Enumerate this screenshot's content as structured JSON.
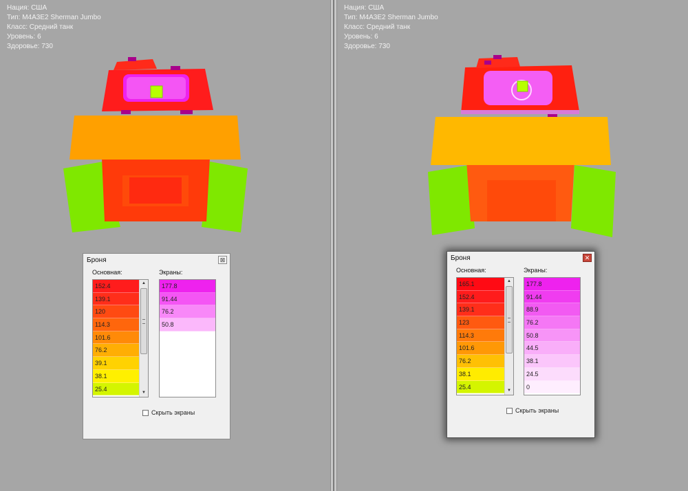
{
  "left": {
    "info": {
      "nation": "Нация: США",
      "type": "Тип: M4A3E2 Sherman Jumbo",
      "class": "Класс: Средний танк",
      "tier": "Уровень: 6",
      "health": "Здоровье: 730"
    },
    "window": {
      "title": "Броня",
      "close_glyph": "⊠",
      "main_header": "Основная:",
      "screens_header": "Экраны:",
      "hide_screens_label": "Скрыть экраны",
      "main_rows": [
        {
          "value": "152.4",
          "color": "#ff1c1c"
        },
        {
          "value": "139.1",
          "color": "#ff2e1a"
        },
        {
          "value": "120",
          "color": "#ff4a12"
        },
        {
          "value": "114.3",
          "color": "#ff660c"
        },
        {
          "value": "101.6",
          "color": "#ff8a08"
        },
        {
          "value": "76.2",
          "color": "#ffae04"
        },
        {
          "value": "39.1",
          "color": "#ffd202"
        },
        {
          "value": "38.1",
          "color": "#fff000"
        },
        {
          "value": "25.4",
          "color": "#d4f500"
        }
      ],
      "screen_rows": [
        {
          "value": "177.8",
          "color": "#ee22ee"
        },
        {
          "value": "91.44",
          "color": "#f455f4"
        },
        {
          "value": "76.2",
          "color": "#f888f8"
        },
        {
          "value": "50.8",
          "color": "#fbb8fb"
        }
      ]
    }
  },
  "right": {
    "info": {
      "nation": "Нация: США",
      "type": "Тип: M4A3E2 Sherman Jumbo",
      "class": "Класс: Средний танк",
      "tier": "Уровень: 6",
      "health": "Здоровье: 730"
    },
    "window": {
      "title": "Броня",
      "close_glyph": "✕",
      "main_header": "Основная:",
      "screens_header": "Экраны:",
      "hide_screens_label": "Скрыть экраны",
      "main_rows": [
        {
          "value": "165.1",
          "color": "#ff0a14"
        },
        {
          "value": "152.4",
          "color": "#ff1c1c"
        },
        {
          "value": "139.1",
          "color": "#ff2e1a"
        },
        {
          "value": "123",
          "color": "#ff5a10"
        },
        {
          "value": "114.3",
          "color": "#ff7a0a"
        },
        {
          "value": "101.6",
          "color": "#ff9806"
        },
        {
          "value": "76.2",
          "color": "#ffc004"
        },
        {
          "value": "38.1",
          "color": "#ffec00"
        },
        {
          "value": "25.4",
          "color": "#d4f500"
        }
      ],
      "screen_rows": [
        {
          "value": "177.8",
          "color": "#ee22ee"
        },
        {
          "value": "91.44",
          "color": "#f03cf0"
        },
        {
          "value": "88.9",
          "color": "#f25af2"
        },
        {
          "value": "76.2",
          "color": "#f577f5"
        },
        {
          "value": "50.8",
          "color": "#f794f7"
        },
        {
          "value": "44.5",
          "color": "#f9aef9"
        },
        {
          "value": "38.1",
          "color": "#fbc6fb"
        },
        {
          "value": "24.5",
          "color": "#fcdcfc"
        },
        {
          "value": "0",
          "color": "#feeefe"
        }
      ]
    }
  }
}
